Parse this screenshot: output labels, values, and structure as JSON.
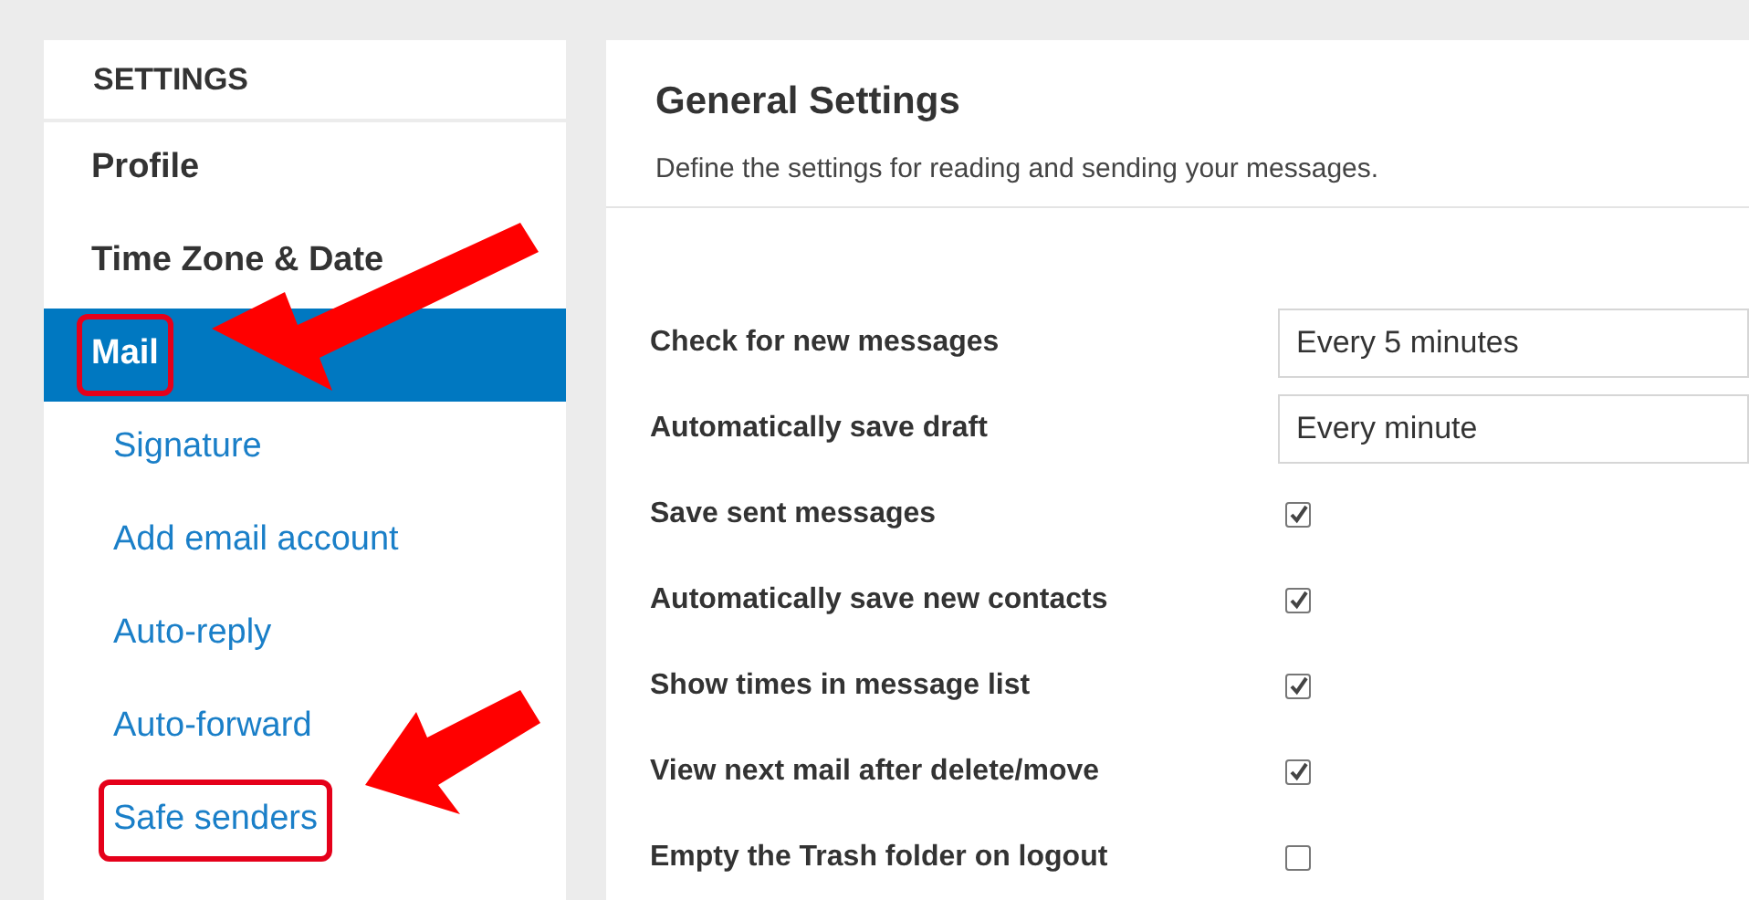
{
  "sidebar": {
    "heading": "SETTINGS",
    "items": [
      {
        "label": "Profile",
        "kind": "section",
        "selected": false,
        "highlighted": false
      },
      {
        "label": "Time Zone & Date",
        "kind": "section",
        "selected": false,
        "highlighted": false
      },
      {
        "label": "Mail",
        "kind": "section",
        "selected": true,
        "highlighted": true
      },
      {
        "label": "Signature",
        "kind": "link",
        "selected": false,
        "highlighted": false
      },
      {
        "label": "Add email account",
        "kind": "link",
        "selected": false,
        "highlighted": false
      },
      {
        "label": "Auto-reply",
        "kind": "link",
        "selected": false,
        "highlighted": false
      },
      {
        "label": "Auto-forward",
        "kind": "link",
        "selected": false,
        "highlighted": false
      },
      {
        "label": "Safe senders",
        "kind": "link",
        "selected": false,
        "highlighted": true
      }
    ]
  },
  "main": {
    "title": "General Settings",
    "description": "Define the settings for reading and sending your messages.",
    "settings": [
      {
        "kind": "select",
        "label": "Check for new messages",
        "value": "Every 5 minutes"
      },
      {
        "kind": "select",
        "label": "Automatically save draft",
        "value": "Every minute"
      },
      {
        "kind": "checkbox",
        "label": "Save sent messages",
        "checked": true
      },
      {
        "kind": "checkbox",
        "label": "Automatically save new contacts",
        "checked": true
      },
      {
        "kind": "checkbox",
        "label": "Show times in message list",
        "checked": true
      },
      {
        "kind": "checkbox",
        "label": "View next mail after delete/move",
        "checked": true
      },
      {
        "kind": "checkbox",
        "label": "Empty the Trash folder on logout",
        "checked": false
      }
    ]
  }
}
